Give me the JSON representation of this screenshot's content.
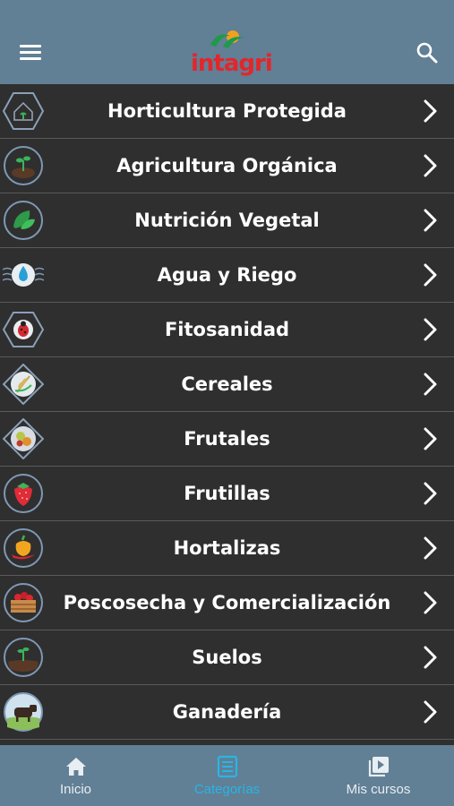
{
  "header": {
    "logo_text": "intagri"
  },
  "categories": [
    {
      "label": "Horticultura Protegida",
      "icon": "greenhouse-icon"
    },
    {
      "label": "Agricultura Orgánica",
      "icon": "sprout-soil-icon"
    },
    {
      "label": "Nutrición Vegetal",
      "icon": "leaf-icon"
    },
    {
      "label": "Agua y Riego",
      "icon": "water-drop-icon"
    },
    {
      "label": "Fitosanidad",
      "icon": "ladybug-icon"
    },
    {
      "label": "Cereales",
      "icon": "wheat-icon"
    },
    {
      "label": "Frutales",
      "icon": "fruits-icon"
    },
    {
      "label": "Frutillas",
      "icon": "strawberry-icon"
    },
    {
      "label": "Hortalizas",
      "icon": "pepper-icon"
    },
    {
      "label": "Poscosecha y Comercialización",
      "icon": "produce-crate-icon"
    },
    {
      "label": "Suelos",
      "icon": "soil-plant-icon"
    },
    {
      "label": "Ganadería",
      "icon": "cattle-icon"
    }
  ],
  "tabs": [
    {
      "label": "Inicio",
      "icon": "home-icon",
      "active": false
    },
    {
      "label": "Categorías",
      "icon": "list-icon",
      "active": true
    },
    {
      "label": "Mis cursos",
      "icon": "play-library-icon",
      "active": false
    }
  ],
  "colors": {
    "header_bg": "#617f95",
    "list_bg": "#2f2f2f",
    "active_tab": "#27b6e6",
    "logo_red": "#e3262b",
    "logo_green": "#1e9a4a",
    "logo_orange": "#f2a01f"
  }
}
